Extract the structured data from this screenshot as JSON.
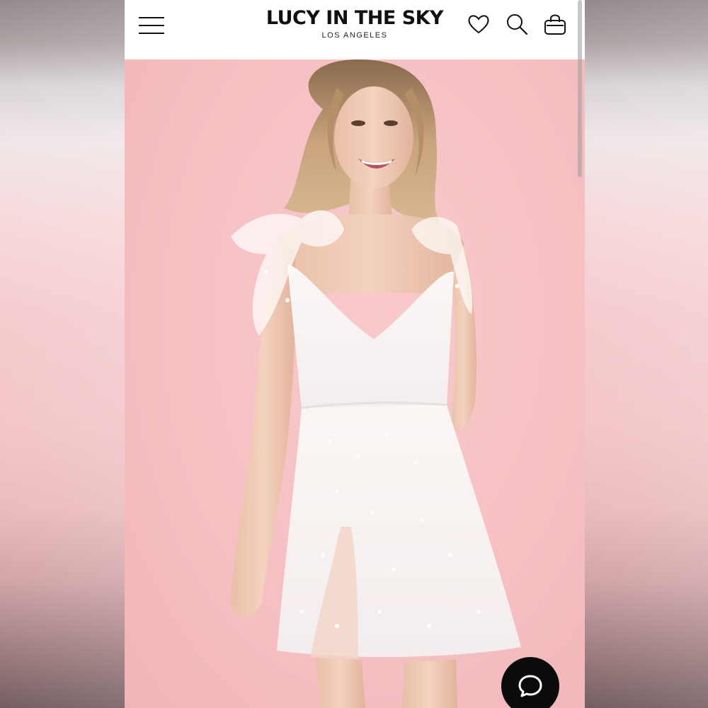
{
  "brand": {
    "name": "LUCY IN THE SKY",
    "location": "LOS ANGELES"
  },
  "icons": {
    "menu": "hamburger-menu-icon",
    "wishlist": "heart-icon",
    "search": "search-icon",
    "cart": "shopping-bag-icon",
    "chat": "chat-bubble-icon"
  },
  "hero": {
    "image": "model-in-white-sequin-mini-dress",
    "background_color": "#f6c3c5"
  },
  "colors": {
    "header_bg": "#ffffff",
    "text": "#111111",
    "chat_button": "#0b0b0b"
  }
}
